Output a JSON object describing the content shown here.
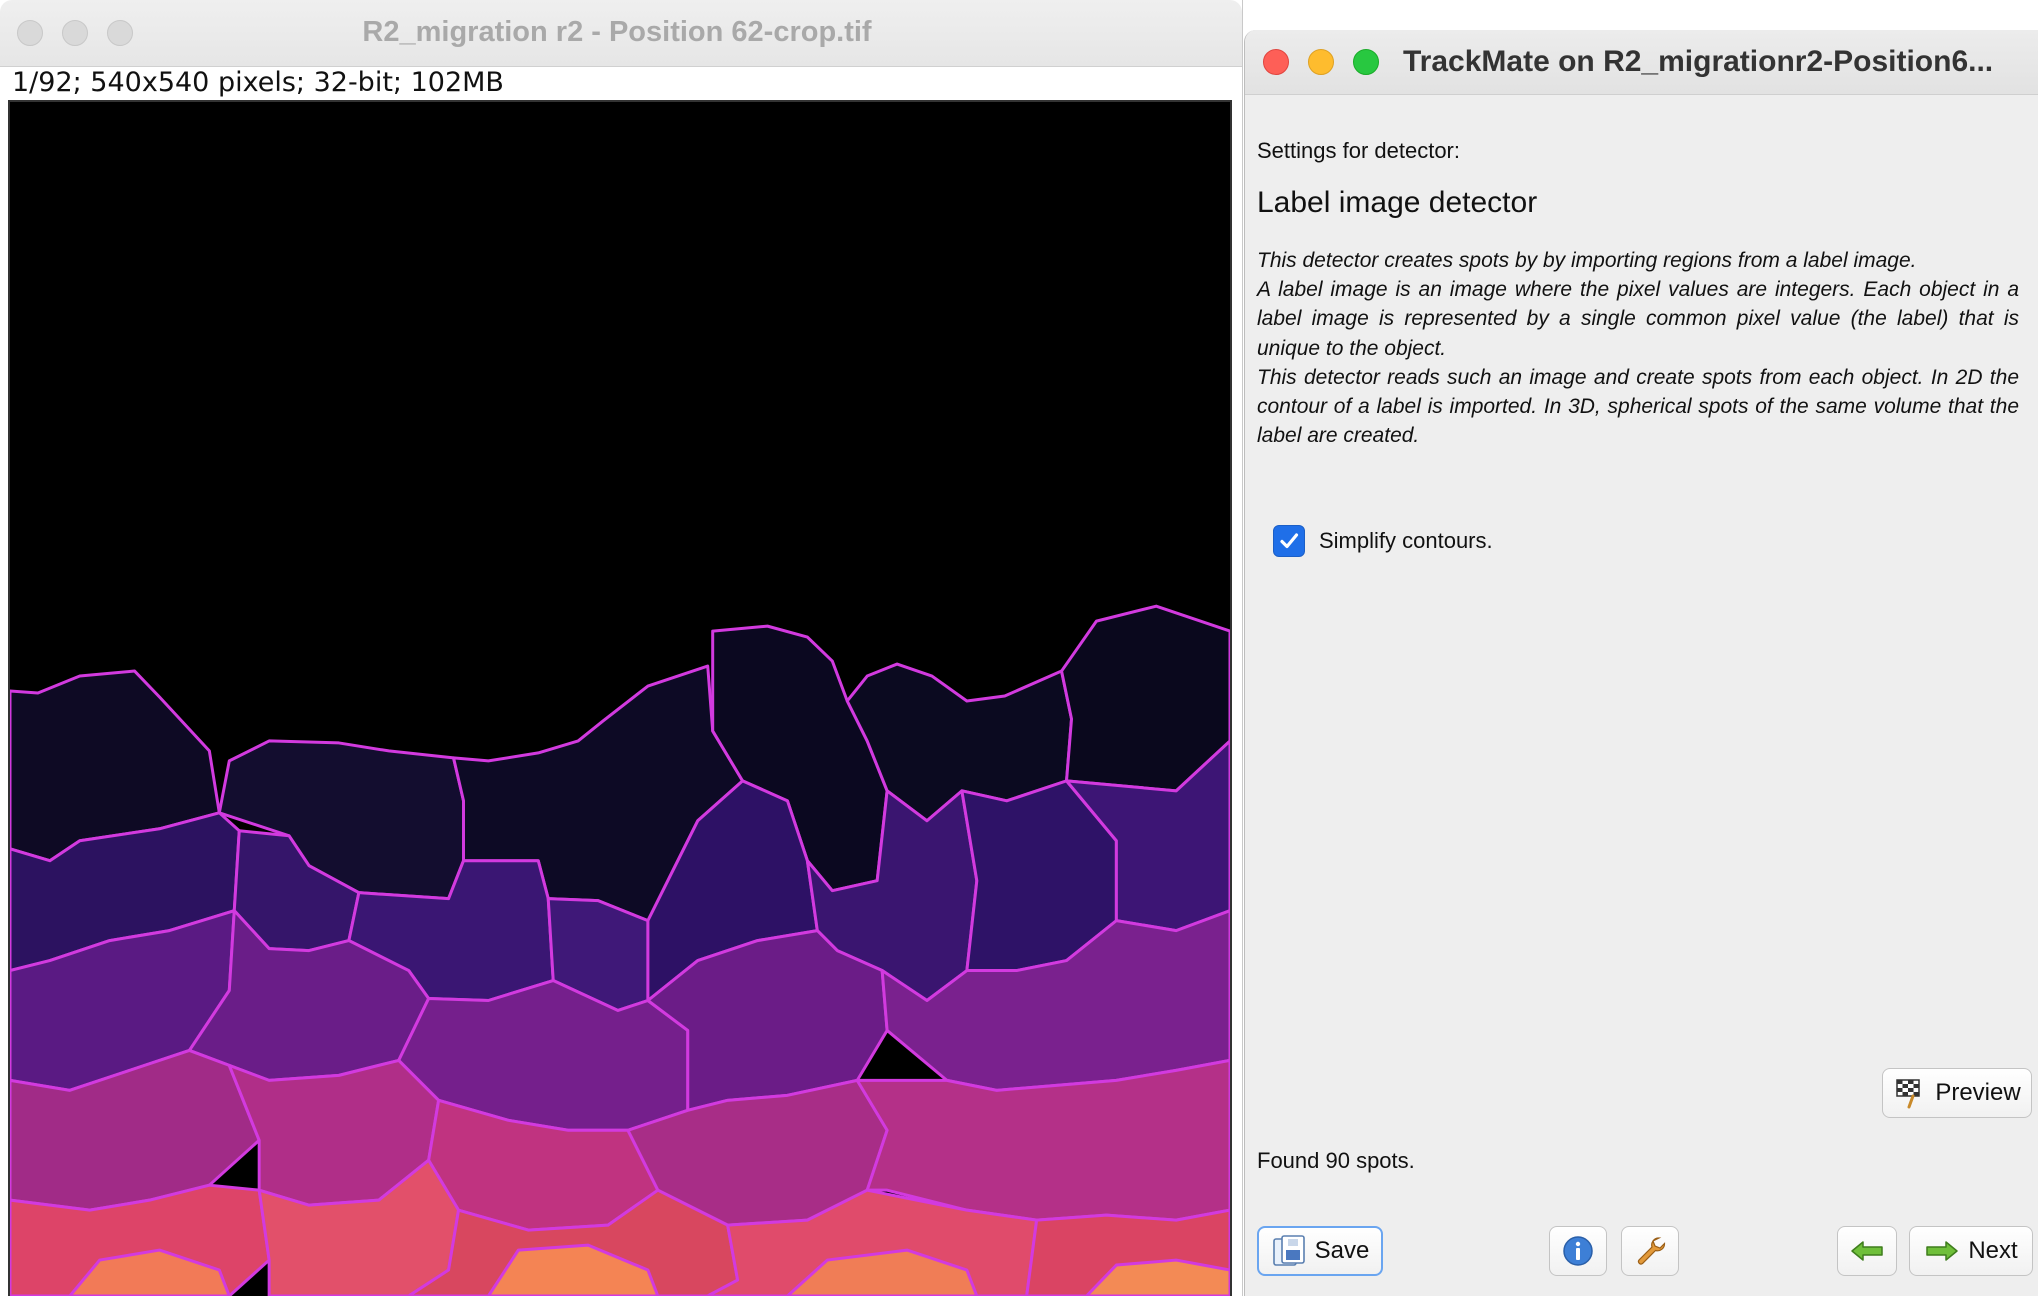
{
  "image_window": {
    "title": "R2_migration r2 - Position 62-crop.tif",
    "info": "1/92; 540x540 pixels; 32-bit; 102MB"
  },
  "trackmate": {
    "title": "TrackMate on R2_migrationr2-Position6...",
    "settings_label": "Settings for detector:",
    "detector_title": "Label image detector",
    "description": [
      "This detector creates spots by by importing regions from a label image.",
      "A label image is an image where the pixel values are integers. Each object in a label image is represented by a single common pixel value (the label) that is unique to the object.",
      "This detector reads such an image and create spots from each object. In 2D the contour of a label is imported. In 3D, spherical spots of the same volume that the label are created."
    ],
    "simplify_contours": {
      "label": "Simplify contours.",
      "checked": true
    },
    "preview_label": "Preview",
    "found_text": "Found 90 spots.",
    "save_label": "Save",
    "next_label": "Next"
  },
  "icons": [
    "checkbox-check-icon",
    "preview-flag-icon",
    "save-disk-icon",
    "info-icon",
    "wrench-icon",
    "back-arrow-icon",
    "next-arrow-icon"
  ],
  "colors": {
    "accent": "#1f6fe8",
    "label_outline": "#d23adf",
    "close": "#fe5f57",
    "minimize": "#febc2e",
    "maximize": "#28c840"
  }
}
